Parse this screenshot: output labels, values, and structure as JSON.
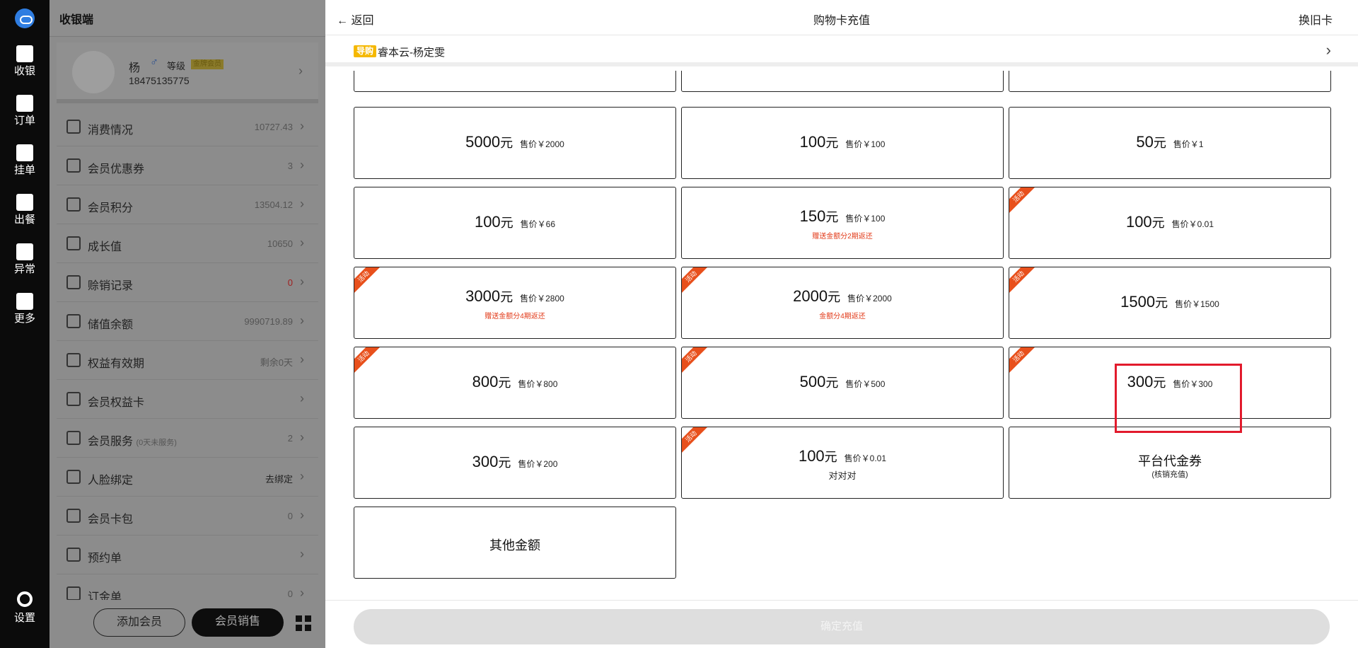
{
  "rail": {
    "items": [
      {
        "label": "收银",
        "icon": "cashier-icon"
      },
      {
        "label": "订单",
        "icon": "order-icon"
      },
      {
        "label": "挂单",
        "icon": "hold-order-icon"
      },
      {
        "label": "出餐",
        "icon": "serve-bell-icon"
      },
      {
        "label": "异常",
        "icon": "exception-icon"
      },
      {
        "label": "更多",
        "icon": "more-grid-icon"
      }
    ],
    "settings_label": "设置"
  },
  "member": {
    "app_title": "收银端",
    "name": "杨",
    "gender_symbol": "♂",
    "level_label": "等级",
    "level_badge": "金牌会员",
    "phone": "18475135775",
    "rows": [
      {
        "label": "消费情况",
        "value": "10727.43"
      },
      {
        "label": "会员优惠券",
        "value": "3"
      },
      {
        "label": "会员积分",
        "value": "13504.12"
      },
      {
        "label": "成长值",
        "value": "10650"
      },
      {
        "label": "赊销记录",
        "value": "0"
      },
      {
        "label": "储值余额",
        "value": "9990719.89"
      },
      {
        "label": "权益有效期",
        "value": "剩余0天"
      },
      {
        "label": "会员权益卡",
        "value": ""
      },
      {
        "label": "会员服务",
        "hint": "(0天未服务)",
        "value": "2"
      },
      {
        "label": "人脸绑定",
        "value": "去绑定"
      },
      {
        "label": "会员卡包",
        "value": "0"
      },
      {
        "label": "预约单",
        "value": ""
      },
      {
        "label": "订金单",
        "value": "0"
      }
    ],
    "add_member": "添加会员",
    "member_sale": "会员销售"
  },
  "drawer": {
    "back_label": "返回",
    "title": "购物卡充值",
    "swap_label": "换旧卡",
    "guide_tag": "导购",
    "guide_name": "睿本云-杨定雯",
    "unit": "元",
    "ribbon_text": "活动",
    "cards": [
      {
        "amount": "5000",
        "price": "售价￥2000"
      },
      {
        "amount": "100",
        "price": "售价￥100"
      },
      {
        "amount": "50",
        "price": "售价￥1"
      },
      {
        "amount": "100",
        "price": "售价￥66"
      },
      {
        "amount": "150",
        "price": "售价￥100",
        "note": "赠送金额分2期返还"
      },
      {
        "amount": "100",
        "price": "售价￥0.01",
        "ribbon": true
      },
      {
        "amount": "3000",
        "price": "售价￥2800",
        "note": "赠送金额分4期返还",
        "ribbon": true
      },
      {
        "amount": "2000",
        "price": "售价￥2000",
        "note": "金额分4期返还",
        "ribbon": true
      },
      {
        "amount": "1500",
        "price": "售价￥1500",
        "ribbon": true
      },
      {
        "amount": "800",
        "price": "售价￥800",
        "ribbon": true
      },
      {
        "amount": "500",
        "price": "售价￥500",
        "ribbon": true
      },
      {
        "amount": "300",
        "price": "售价￥300",
        "ribbon": true
      },
      {
        "amount": "300",
        "price": "售价￥200"
      },
      {
        "amount": "100",
        "price": "售价￥0.01",
        "note_dark": "对对对",
        "ribbon": true
      }
    ],
    "platform_title": "平台代金券",
    "platform_sub": "(核销充值)",
    "other_amount": "其他金额",
    "confirm_label": "确定充值"
  }
}
